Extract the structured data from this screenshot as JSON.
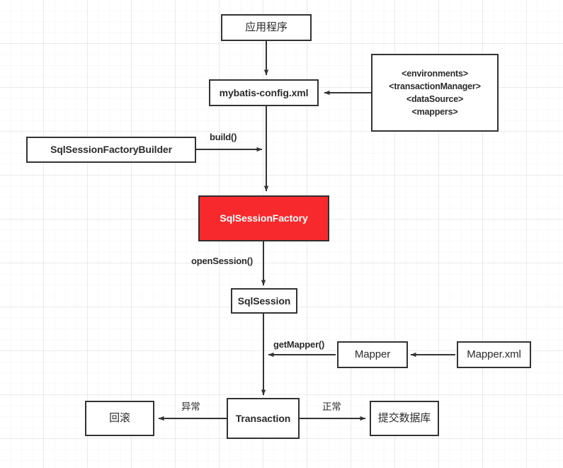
{
  "diagram": {
    "title": "MyBatis execution flow diagram",
    "accent_red": "#f8292c",
    "stroke_color": "#333333",
    "background": "#ffffff",
    "nodes": {
      "application": "应用程序",
      "config": "mybatis-config.xml",
      "xml_elements": "<environments>\n<transactionManager>\n<dataSource>\n<mappers>",
      "builder": "SqlSessionFactoryBuilder",
      "factory": "SqlSessionFactory",
      "session": "SqlSession",
      "mapper": "Mapper",
      "mapper_xml": "Mapper.xml",
      "transaction": "Transaction",
      "rollback": "回滚",
      "commit": "提交数据库"
    },
    "edge_labels": {
      "build": "build()",
      "open_session": "openSession()",
      "get_mapper": "getMapper()",
      "exception": "异常",
      "normal": "正常"
    }
  }
}
